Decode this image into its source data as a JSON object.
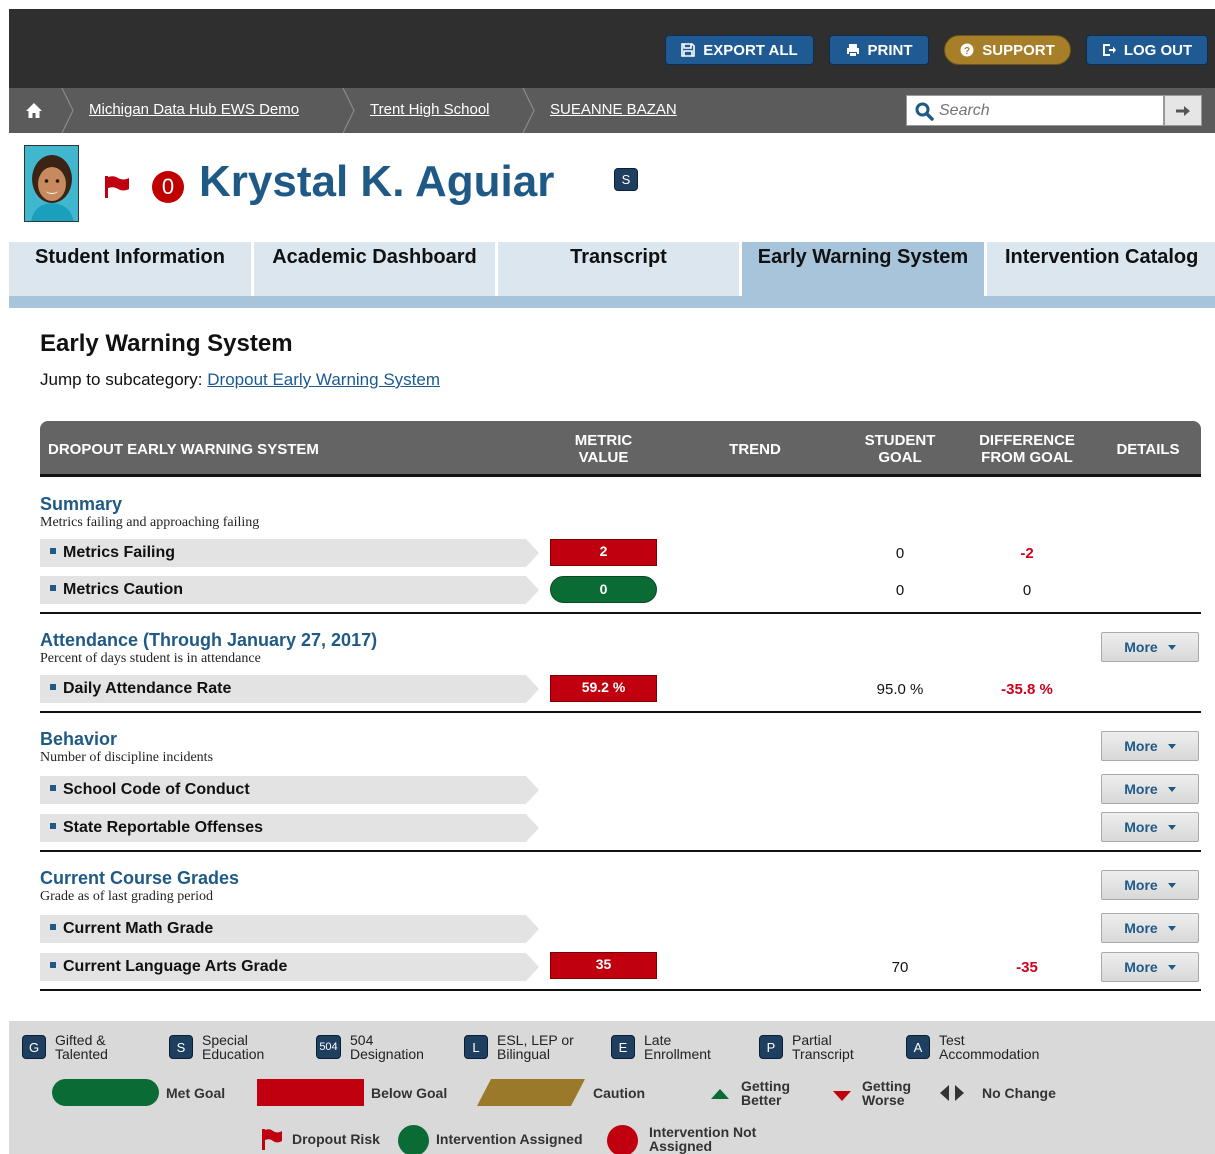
{
  "toolbar": {
    "export_label": "EXPORT ALL",
    "print_label": "PRINT",
    "support_label": "SUPPORT",
    "logout_label": "LOG OUT"
  },
  "breadcrumb": {
    "items": [
      "Michigan Data Hub EWS Demo",
      "Trent High School",
      "SUEANNE BAZAN"
    ]
  },
  "search": {
    "placeholder": "Search"
  },
  "student": {
    "name": "Krystal K. Aguiar",
    "flag_count": "0",
    "badge": "S"
  },
  "tabs": [
    {
      "label": "Student Information"
    },
    {
      "label": "Academic Dashboard"
    },
    {
      "label": "Transcript"
    },
    {
      "label": "Early Warning System",
      "active": true
    },
    {
      "label": "Intervention Catalog"
    }
  ],
  "page": {
    "title": "Early Warning System",
    "jump_prefix": "Jump to subcategory: ",
    "jump_link": "Dropout Early Warning System"
  },
  "table": {
    "headers": {
      "category": "DROPOUT EARLY WARNING SYSTEM",
      "metric_value": [
        "METRIC",
        "VALUE"
      ],
      "trend": "TREND",
      "student_goal": [
        "STUDENT",
        "GOAL"
      ],
      "difference": [
        "DIFFERENCE",
        "FROM GOAL"
      ],
      "details": "DETAILS"
    },
    "more_label": "More",
    "groups": {
      "summary": {
        "title": "Summary",
        "desc": "Metrics failing and approaching failing",
        "rows": [
          {
            "label": "Metrics Failing",
            "value": "2",
            "status": "below",
            "goal": "0",
            "diff": "-2"
          },
          {
            "label": "Metrics Caution",
            "value": "0",
            "status": "met",
            "goal": "0",
            "diff": "0"
          }
        ]
      },
      "attendance": {
        "title": "Attendance  (Through January 27, 2017)",
        "desc": "Percent of days student is in attendance",
        "rows": [
          {
            "label": "Daily Attendance Rate",
            "value": "59.2 %",
            "status": "below",
            "goal": "95.0 %",
            "diff": "-35.8 %"
          }
        ]
      },
      "behavior": {
        "title": "Behavior",
        "desc": "Number of discipline incidents",
        "rows": [
          {
            "label": "School Code of Conduct"
          },
          {
            "label": "State Reportable Offenses"
          }
        ]
      },
      "grades": {
        "title": "Current Course Grades",
        "desc": "Grade as of last grading period",
        "rows": [
          {
            "label": "Current Math Grade"
          },
          {
            "label": "Current Language Arts Grade",
            "value": "35",
            "status": "below",
            "goal": "70",
            "diff": "-35"
          }
        ]
      }
    }
  },
  "legend": {
    "badges": [
      {
        "code": "G",
        "label": [
          "Gifted &",
          "Talented"
        ]
      },
      {
        "code": "S",
        "label": [
          "Special",
          "Education"
        ]
      },
      {
        "code": "504",
        "label": [
          "504",
          "Designation"
        ]
      },
      {
        "code": "L",
        "label": [
          "ESL, LEP or",
          "Bilingual"
        ]
      },
      {
        "code": "E",
        "label": [
          "Late",
          "Enrollment"
        ]
      },
      {
        "code": "P",
        "label": [
          "Partial",
          "Transcript"
        ]
      },
      {
        "code": "A",
        "label": [
          "Test",
          "Accommodation"
        ]
      }
    ],
    "met_goal": "Met Goal",
    "below_goal": "Below Goal",
    "caution": "Caution",
    "getting_better": [
      "Getting",
      "Better"
    ],
    "getting_worse": [
      "Getting",
      "Worse"
    ],
    "no_change": "No Change",
    "dropout_risk": "Dropout Risk",
    "intervention_assigned": "Intervention Assigned",
    "intervention_not_assigned": [
      "Intervention Not",
      "Assigned"
    ]
  },
  "colors": {
    "below": "#c0000f",
    "met": "#0b6b35",
    "caution": "#9a7a2a",
    "accent": "#1f5a86"
  }
}
